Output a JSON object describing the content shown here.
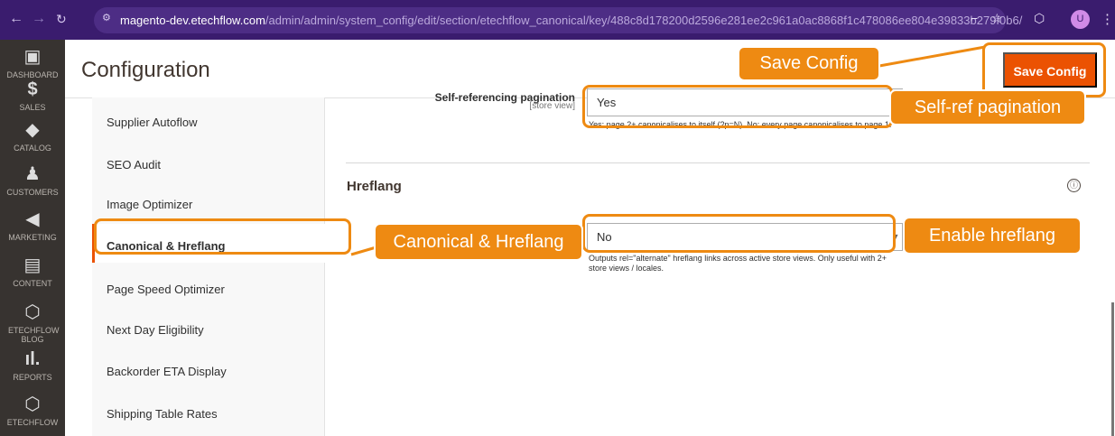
{
  "browser": {
    "back_icon": "back-arrow-icon",
    "forward_icon": "forward-arrow-icon",
    "reload_icon": "reload-icon",
    "url_prefix": "magento-dev.etechflow.com",
    "url_path": "/admin/admin/system_config/edit/section/etechflow_canonical/key/488c8d178200d2596e281ee2c961a0ac8868f1c478086ee804e39833b279f0b6/",
    "profile_initial": "U"
  },
  "sidebar": [
    {
      "label": "DASHBOARD",
      "icon": "dashboard-icon"
    },
    {
      "label": "SALES",
      "icon": "dollar-icon"
    },
    {
      "label": "CATALOG",
      "icon": "cube-icon"
    },
    {
      "label": "CUSTOMERS",
      "icon": "person-icon"
    },
    {
      "label": "MARKETING",
      "icon": "megaphone-icon"
    },
    {
      "label": "CONTENT",
      "icon": "content-icon"
    },
    {
      "label": "ETECHFLOW BLOG",
      "icon": "hexagon-icon"
    },
    {
      "label": "REPORTS",
      "icon": "bar-chart-icon"
    },
    {
      "label": "ETECHFLOW",
      "icon": "hexagon-icon"
    }
  ],
  "page": {
    "title": "Configuration",
    "save_button": "Save Config"
  },
  "config_nav": [
    "Supplier Autoflow",
    "SEO Audit",
    "Image Optimizer",
    "Canonical & Hreflang",
    "Page Speed Optimizer",
    "Next Day Eligibility",
    "Backorder ETA Display",
    "Shipping Table Rates"
  ],
  "settings": {
    "self_ref": {
      "label": "Self-referencing pagination",
      "scope": "[store view]",
      "value": "Yes",
      "note": "Yes: page 2+ canonicalises to itself (?p=N). No: every page canonicalises to page 1."
    },
    "hreflang": {
      "section_title": "Hreflang",
      "value": "No",
      "note": "Outputs rel=\"alternate\" hreflang links across active store views. Only useful with 2+ store views / locales."
    }
  },
  "callouts": {
    "save": "Save Config",
    "self_ref": "Self-ref pagination",
    "canonical": "Canonical & Hreflang",
    "enable_hreflang": "Enable hreflang"
  },
  "colors": {
    "accent": "#eb5202",
    "callout": "#ee8a12",
    "sidebar": "#373330",
    "browser": "#3a1c6e"
  }
}
